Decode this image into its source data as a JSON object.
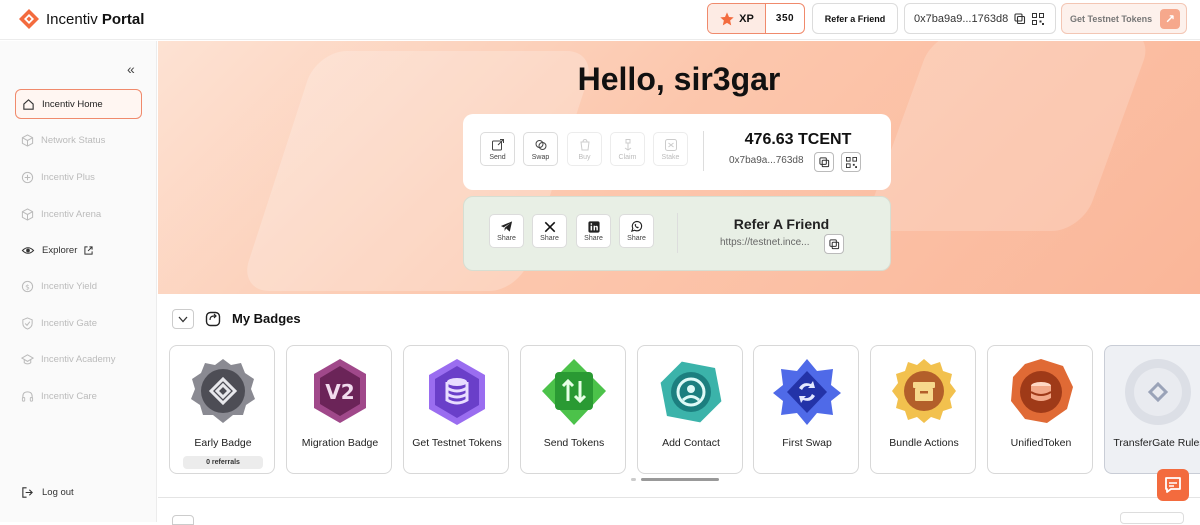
{
  "header": {
    "logo_word": "Incentiv",
    "logo_word2": "Portal",
    "xp_label": "XP",
    "xp_value": "350",
    "refer_label": "Refer a Friend",
    "address": "0x7ba9a9...1763d8",
    "testnet_label": "Get Testnet Tokens"
  },
  "sidebar": {
    "items": [
      {
        "label": "Incentiv Home",
        "icon": "home-icon"
      },
      {
        "label": "Network Status",
        "icon": "cube-icon"
      },
      {
        "label": "Incentiv Plus",
        "icon": "plus-circle-icon"
      },
      {
        "label": "Incentiv Arena",
        "icon": "cube-icon"
      },
      {
        "label": "Explorer",
        "icon": "eye-icon"
      },
      {
        "label": "Incentiv Yield",
        "icon": "dollar-icon"
      },
      {
        "label": "Incentiv Gate",
        "icon": "shield-icon"
      },
      {
        "label": "Incentiv Academy",
        "icon": "academy-icon"
      },
      {
        "label": "Incentiv Care",
        "icon": "headset-icon"
      }
    ],
    "logout": "Log out"
  },
  "hero": {
    "greeting": "Hello, sir3gar",
    "actions": [
      "Send",
      "Swap",
      "Buy",
      "Claim",
      "Stake"
    ],
    "balance": "476.63 TCENT",
    "address": "0x7ba9a...763d8",
    "share_actions": [
      "Share",
      "Share",
      "Share",
      "Share"
    ],
    "refer_title": "Refer A Friend",
    "refer_url": "https://testnet.ince..."
  },
  "badges": {
    "title": "My Badges",
    "items": [
      {
        "name": "Early Badge",
        "sub": "0 referrals",
        "color": "#5b5b63"
      },
      {
        "name": "Migration Badge",
        "color": "#7b2f6b"
      },
      {
        "name": "Get Testnet Tokens",
        "color": "#7a4fd6"
      },
      {
        "name": "Send Tokens",
        "color": "#2fa33c"
      },
      {
        "name": "Add Contact",
        "color": "#1f8a8a"
      },
      {
        "name": "First Swap",
        "color": "#2f47c7"
      },
      {
        "name": "Bundle Actions",
        "color": "#e6a531"
      },
      {
        "name": "UnifiedToken",
        "color": "#d4582a"
      },
      {
        "name": "TransferGate Rules",
        "color": "#c8ccd6"
      }
    ]
  }
}
